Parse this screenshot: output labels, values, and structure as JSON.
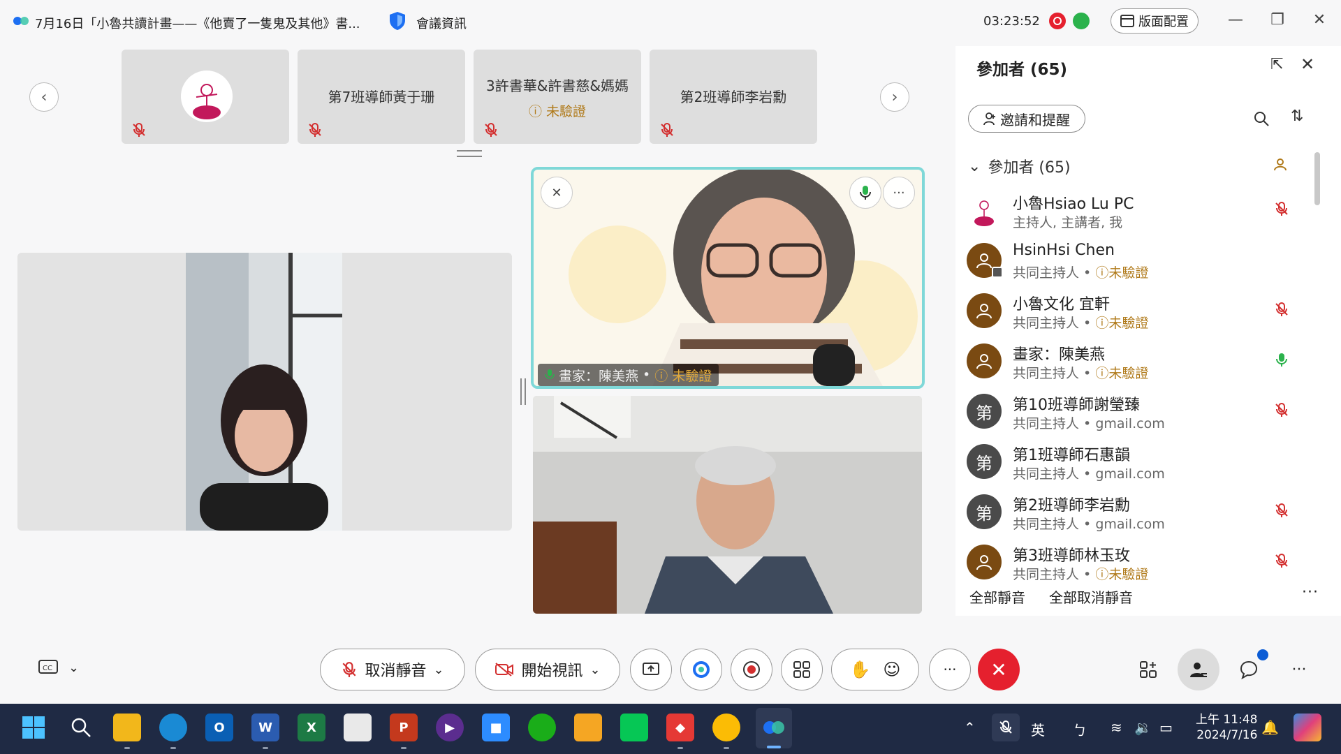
{
  "titlebar": {
    "title": "7月16日「小魯共讀計畫——《他賣了一隻鬼及其他》書...",
    "meeting_info": "會議資訊",
    "elapsed": "03:23:52",
    "layout_label": "版面配置"
  },
  "filmstrip": [
    {
      "name": "",
      "avatar": "logo"
    },
    {
      "name": "第7班導師黃于珊"
    },
    {
      "name": "3許書華&許書慈&媽媽",
      "status": "未驗證"
    },
    {
      "name": "第2班導師李岩勳"
    }
  ],
  "active_speaker": {
    "name": "畫家：陳美燕",
    "separator": "•",
    "status": "未驗證"
  },
  "panel": {
    "title": "參加者 (65)",
    "invite_label": "邀請和提醒",
    "group_label": "參加者 (65)",
    "participants": [
      {
        "name": "小魯Hsiao Lu PC",
        "role": "主持人, 主講者, 我",
        "avatar": "logo",
        "mic": "muted"
      },
      {
        "name": "HsinHsi Chen",
        "role": "共同主持人",
        "status": "未驗證",
        "avatar": "person",
        "mic": "none",
        "phone": true
      },
      {
        "name": "小魯文化 宜軒",
        "role": "共同主持人",
        "status": "未驗證",
        "avatar": "person",
        "mic": "muted"
      },
      {
        "name": "畫家：陳美燕",
        "role": "共同主持人",
        "status": "未驗證",
        "avatar": "person",
        "mic": "active"
      },
      {
        "name": "第10班導師謝瑩臻",
        "role": "共同主持人",
        "status_text": "gmail.com",
        "avatar": "letter",
        "letter": "第",
        "mic": "muted"
      },
      {
        "name": "第1班導師石惠韻",
        "role": "共同主持人",
        "status_text": "gmail.com",
        "avatar": "letter",
        "letter": "第",
        "mic": "none"
      },
      {
        "name": "第2班導師李岩勳",
        "role": "共同主持人",
        "status_text": "gmail.com",
        "avatar": "letter",
        "letter": "第",
        "mic": "muted"
      },
      {
        "name": "第3班導師林玉玫",
        "role": "共同主持人",
        "status": "未驗證",
        "avatar": "person",
        "mic": "muted"
      }
    ],
    "mute_all": "全部靜音",
    "unmute_all": "全部取消靜音"
  },
  "toolbar": {
    "unmute_label": "取消靜音",
    "start_video_label": "開始視訊"
  },
  "taskbar": {
    "ime_lang": "英",
    "ime_mode": "ㄅ",
    "time": "上午 11:48",
    "date": "2024/7/16"
  },
  "colors": {
    "accent_teal": "#7fd8d8",
    "end_red": "#e5202e",
    "unverified": "#b07a1a",
    "avatar_brown": "#7a4a12",
    "avatar_gray": "#4a4a4a",
    "mic_green": "#2bb24c"
  }
}
